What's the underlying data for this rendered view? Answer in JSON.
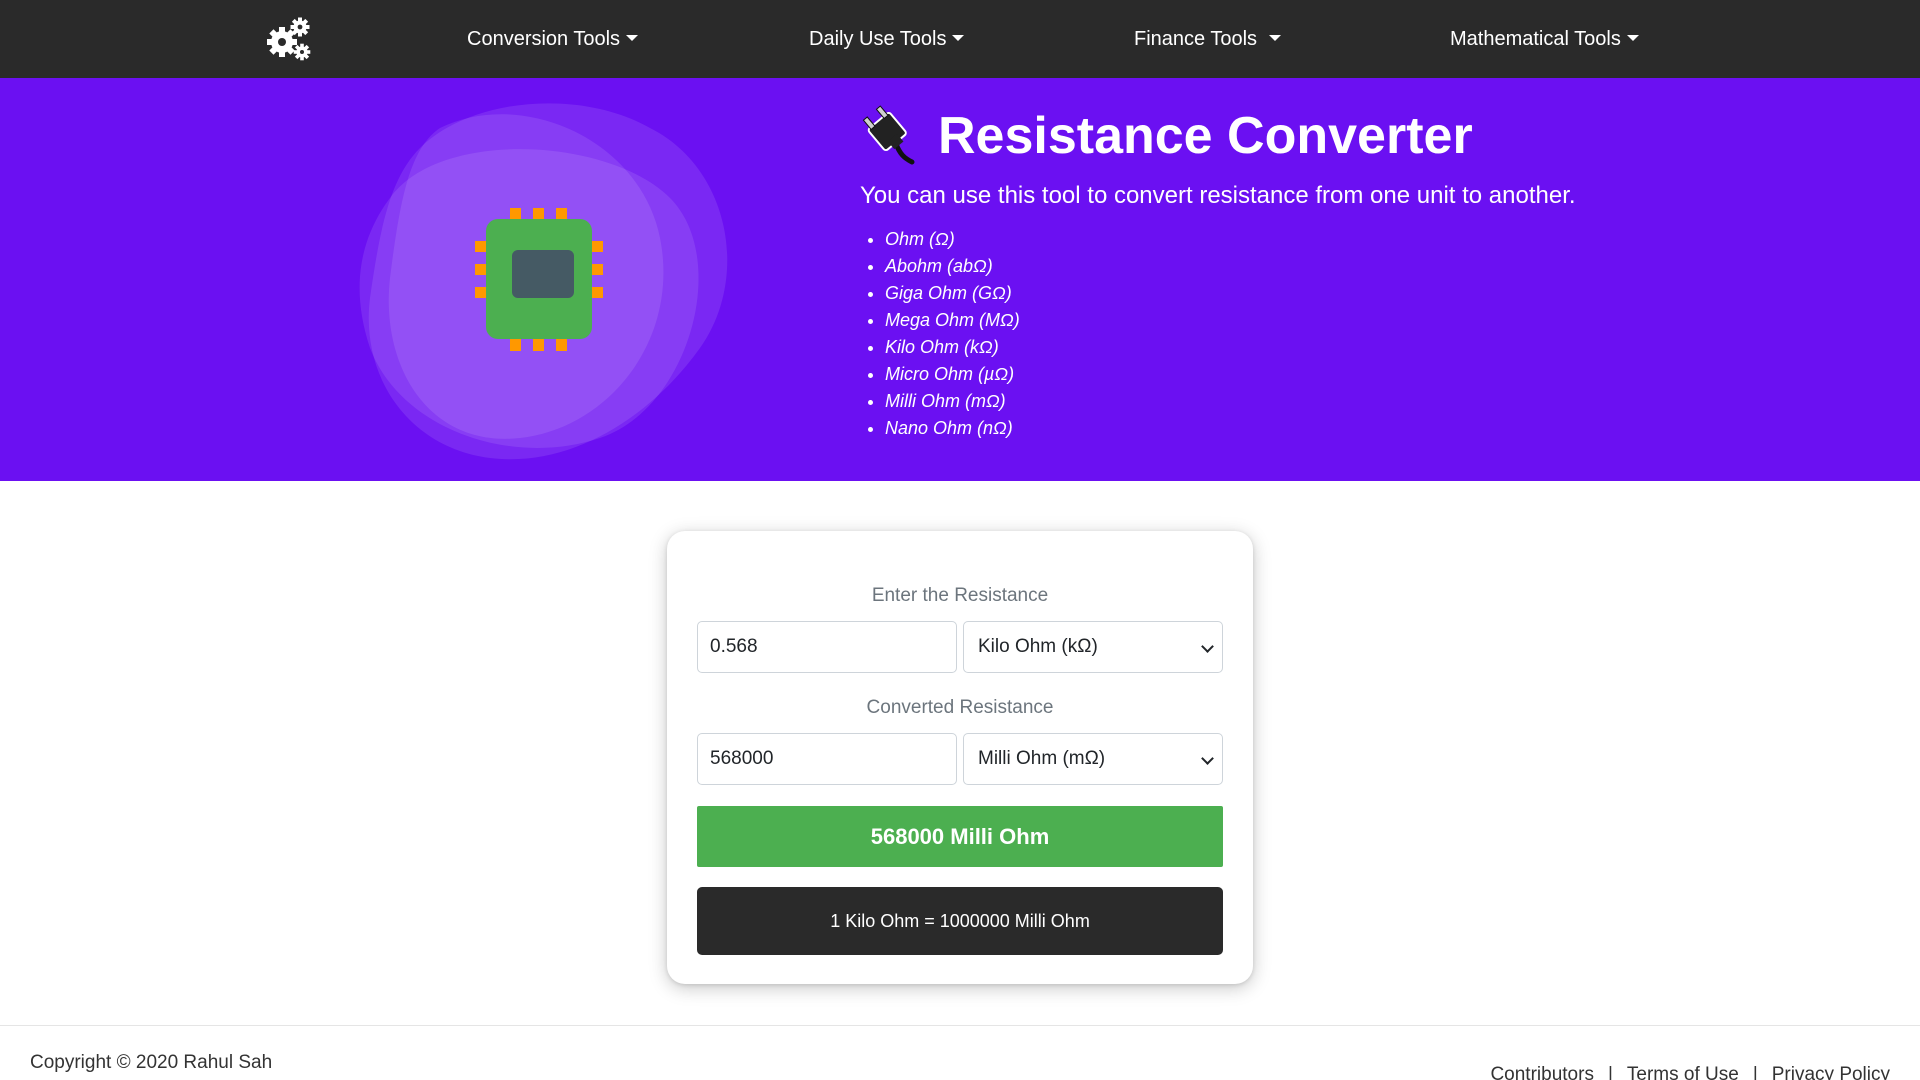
{
  "nav": {
    "logo_icon": "gears-icon",
    "items": [
      {
        "label": "Conversion Tools"
      },
      {
        "label": "Daily Use Tools"
      },
      {
        "label": "Finance Tools"
      },
      {
        "label": "Mathematical Tools"
      }
    ]
  },
  "hero": {
    "background": "#6b10f2",
    "illustration_icon": "chip-icon",
    "title_icon": "plug-icon",
    "title": "Resistance Converter",
    "description": "You can use this tool to convert resistance from one unit to another.",
    "units": [
      "Ohm (Ω)",
      "Abohm (abΩ)",
      "Giga Ohm (GΩ)",
      "Mega Ohm (MΩ)",
      "Kilo Ohm (kΩ)",
      "Micro Ohm (µΩ)",
      "Milli Ohm (mΩ)",
      "Nano Ohm (nΩ)"
    ]
  },
  "converter": {
    "input_label": "Enter the Resistance",
    "input_value": "0.568",
    "input_unit": "Kilo Ohm (kΩ)",
    "output_label": "Converted Resistance",
    "output_value": "568000",
    "output_unit": "Milli Ohm (mΩ)",
    "result": "568000 Milli Ohm",
    "formula": "1 Kilo Ohm = 1000000 Milli Ohm",
    "result_color": "#4caf50",
    "formula_color": "#2a2a2a"
  },
  "footer": {
    "copyright": "Copyright © 2020 Rahul Sah",
    "links": [
      {
        "label": "Contributors"
      },
      {
        "label": "Terms of Use"
      },
      {
        "label": "Privacy Policy"
      }
    ],
    "separator": "|"
  }
}
